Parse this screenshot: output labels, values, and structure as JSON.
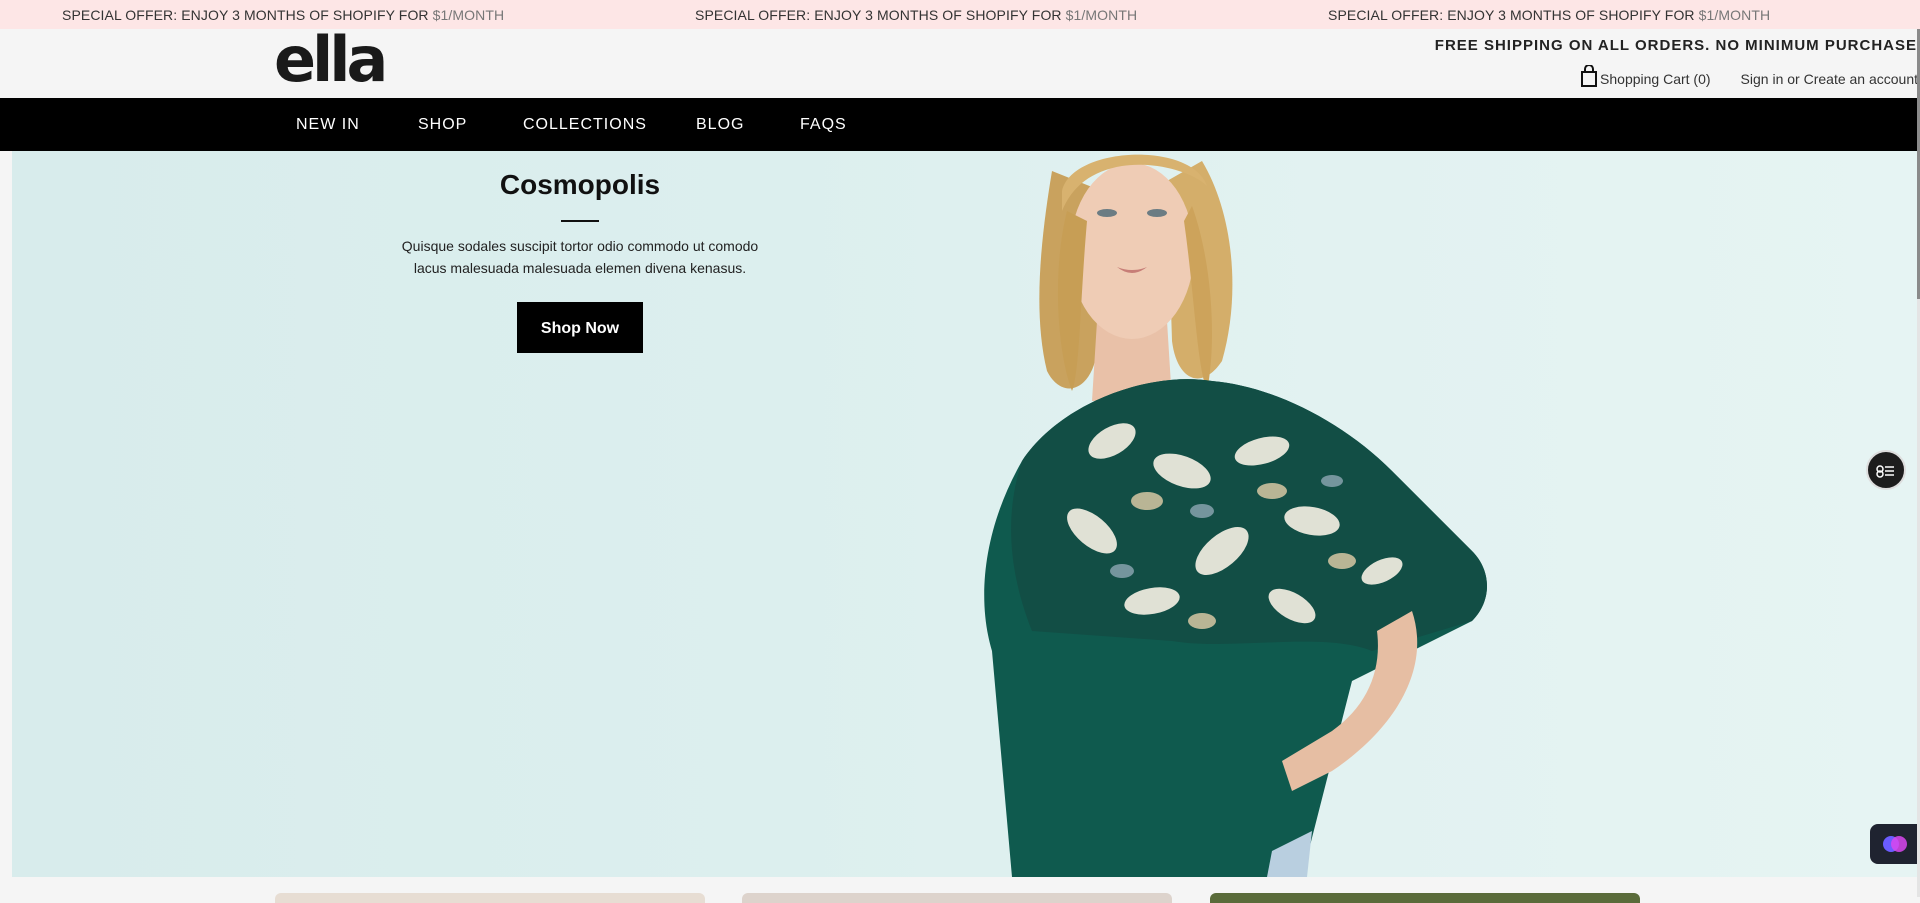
{
  "announcement": {
    "messages": [
      {
        "text": "SPECIAL OFFER: ENJOY 3 MONTHS OF SHOPIFY FOR ",
        "price": "$1/MONTH"
      },
      {
        "text": "SPECIAL OFFER: ENJOY 3 MONTHS OF SHOPIFY FOR ",
        "price": "$1/MONTH"
      },
      {
        "text": "SPECIAL OFFER: ENJOY 3 MONTHS OF SHOPIFY FOR ",
        "price": "$1/MONTH"
      }
    ]
  },
  "header": {
    "logo": "ella",
    "shipping_notice": "FREE SHIPPING ON ALL ORDERS. NO MINIMUM PURCHASE",
    "cart_label": "Shopping Cart (0)",
    "sign_in": "Sign in",
    "or": " or ",
    "create_account": "Create an account"
  },
  "nav": {
    "items": [
      "NEW IN",
      "SHOP",
      "COLLECTIONS",
      "BLOG",
      "FAQS"
    ]
  },
  "hero": {
    "title": "Cosmopolis",
    "text": "Quisque sodales suscipit tortor odio commodo ut comodo lacus malesuada malesuada elemen divena kenasus.",
    "button": "Shop Now"
  },
  "colors": {
    "announcement_bg": "#fde6e6",
    "nav_bg": "#000000",
    "hero_bg": "#dcefee",
    "top_green": "#0f5a4e"
  },
  "icons": [
    "shopping-bag-icon",
    "filter-icon",
    "chat-icon"
  ]
}
